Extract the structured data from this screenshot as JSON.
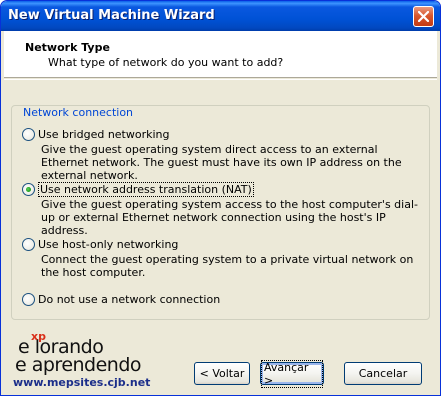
{
  "window": {
    "title": "New Virtual Machine Wizard"
  },
  "header": {
    "title": "Network Type",
    "subtitle": "What type of network do you want to add?"
  },
  "group": {
    "legend": "Network connection",
    "options": [
      {
        "label": "Use bridged networking",
        "selected": false,
        "description": "Give the guest operating system direct access to an external Ethernet network. The guest must have its own IP address on the external network."
      },
      {
        "label": "Use network address translation (NAT)",
        "selected": true,
        "description": "Give the guest operating system access to the host computer's dial-up or external Ethernet network connection using the host's IP address."
      },
      {
        "label": "Use host-only networking",
        "selected": false,
        "description": "Connect the guest operating system to a private virtual network on the host computer."
      },
      {
        "label": "Do not use a network connection",
        "selected": false,
        "description": ""
      }
    ]
  },
  "brand": {
    "xp": "xp",
    "line1": "e   lorando",
    "line2": "e aprendendo",
    "url": "www.mepsites.cjb.net"
  },
  "buttons": {
    "back": "< Voltar",
    "next": "Avançar >",
    "cancel": "Cancelar"
  },
  "colors": {
    "titlebar": "#0052d6",
    "window_bg": "#ece9d8",
    "legend_text": "#0046d5",
    "radio_dot": "#21a121",
    "close_button": "#d9582e"
  }
}
